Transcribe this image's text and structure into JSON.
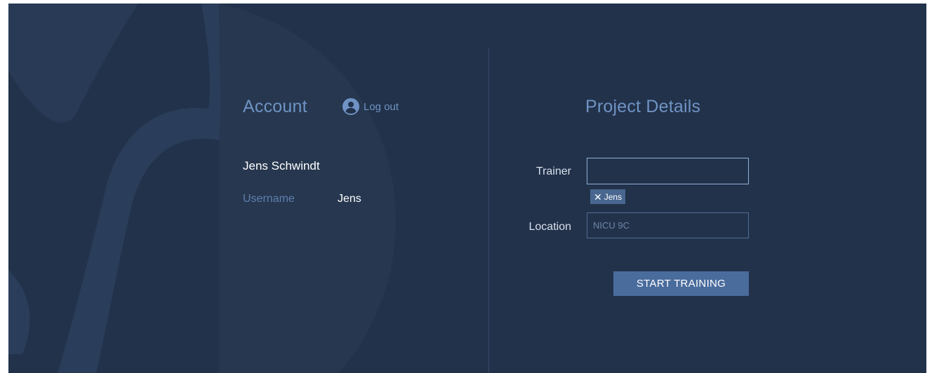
{
  "account": {
    "title": "Account",
    "logout_label": "Log out",
    "full_name": "Jens Schwindt",
    "username_label": "Username",
    "username_value": "Jens"
  },
  "project": {
    "title": "Project Details",
    "trainer_label": "Trainer",
    "trainer_value": "",
    "trainer_chip": "Jens",
    "location_label": "Location",
    "location_placeholder": "NICU 9C",
    "start_button": "START TRAINING"
  },
  "icons": {
    "logout": "user-circle-icon",
    "chip_remove": "close-icon",
    "remove_glyph": "✕"
  },
  "colors": {
    "background": "#22324a",
    "accent": "#6f93c4",
    "button": "#4a6c9d"
  }
}
